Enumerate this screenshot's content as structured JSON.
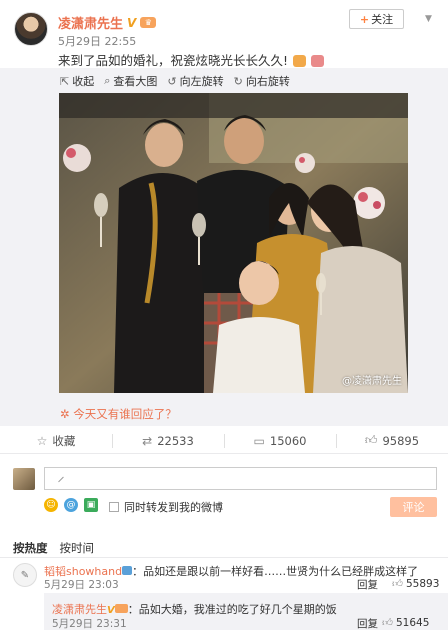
{
  "post": {
    "author": "凌潇肃先生",
    "verified_mark": "V",
    "time": "5月29日 22:55",
    "follow_label": "关注",
    "text": "来到了品如的婚礼，祝瓷炫晓光长长久久!"
  },
  "photo_toolbar": [
    {
      "label": "收起",
      "icon": "collapse-icon"
    },
    {
      "label": "查看大图",
      "icon": "zoom-icon"
    },
    {
      "label": "向左旋转",
      "icon": "rotate-left-icon"
    },
    {
      "label": "向右旋转",
      "icon": "rotate-right-icon"
    }
  ],
  "photo": {
    "watermark": "@凌潇肃先生"
  },
  "prompt_link": "今天又有谁回应了？",
  "actions": {
    "favorite": "收藏",
    "repost_count": "22533",
    "comment_count": "15060",
    "like_count": "95895"
  },
  "composer": {
    "repost_checkbox_label": "同时转发到我的微博",
    "submit_label": "评论"
  },
  "sort_tabs": {
    "hot": "按热度",
    "time": "按时间"
  },
  "comments": [
    {
      "user": "韬韬showhand",
      "text": "：品如还是跟以前一样好看……世贤为什么已经胖成这样了",
      "time": "5月29日 23:03",
      "reply_label": "回复",
      "likes": "55893"
    },
    {
      "user": "凌潇肃先生",
      "text": "：品如大婚，我准过的吃了好几个星期的饭",
      "time": "5月29日 23:31",
      "reply_label": "回复",
      "likes": "51645"
    }
  ],
  "colors": {
    "accent": "#eb7350",
    "gold_badge": "#f0a020",
    "submit_disabled": "#ffc09f",
    "media_bg": "#f2f2f5"
  }
}
